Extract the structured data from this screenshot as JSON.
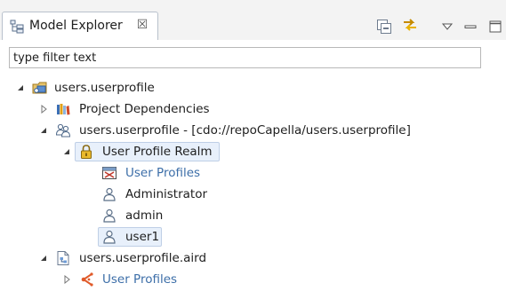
{
  "view": {
    "tab_title": "Model Explorer",
    "tab_close_glyph": "☒"
  },
  "toolbar": {
    "icons": [
      "collapse-all-icon",
      "link-with-editor-icon",
      "view-menu-icon",
      "minimize-icon",
      "maximize-icon"
    ]
  },
  "filter": {
    "placeholder": "type filter text",
    "value": ""
  },
  "tree": {
    "root": {
      "label": "users.userprofile",
      "expanded": true
    },
    "project_dependencies": {
      "label": "Project Dependencies",
      "expanded": false
    },
    "resource": {
      "label": "users.userprofile - [cdo://repoCapella/users.userprofile]",
      "expanded": true
    },
    "realm": {
      "label": "User Profile Realm",
      "expanded": true,
      "selected": true
    },
    "realm_children": [
      {
        "label": "User Profiles",
        "icon": "user-profiles-icon"
      },
      {
        "label": "Administrator",
        "icon": "user-icon"
      },
      {
        "label": "admin",
        "icon": "user-icon"
      },
      {
        "label": "user1",
        "icon": "user-icon",
        "selected": true
      }
    ],
    "aird": {
      "label": "users.userprofile.aird",
      "expanded": true
    },
    "aird_children": [
      {
        "label": "User Profiles",
        "icon": "representation-icon",
        "expanded": false
      }
    ]
  },
  "colors": {
    "link_label": "#3c6ea8",
    "selection_bg": "#e8f0fb",
    "selection_border": "#bfcfe6"
  }
}
